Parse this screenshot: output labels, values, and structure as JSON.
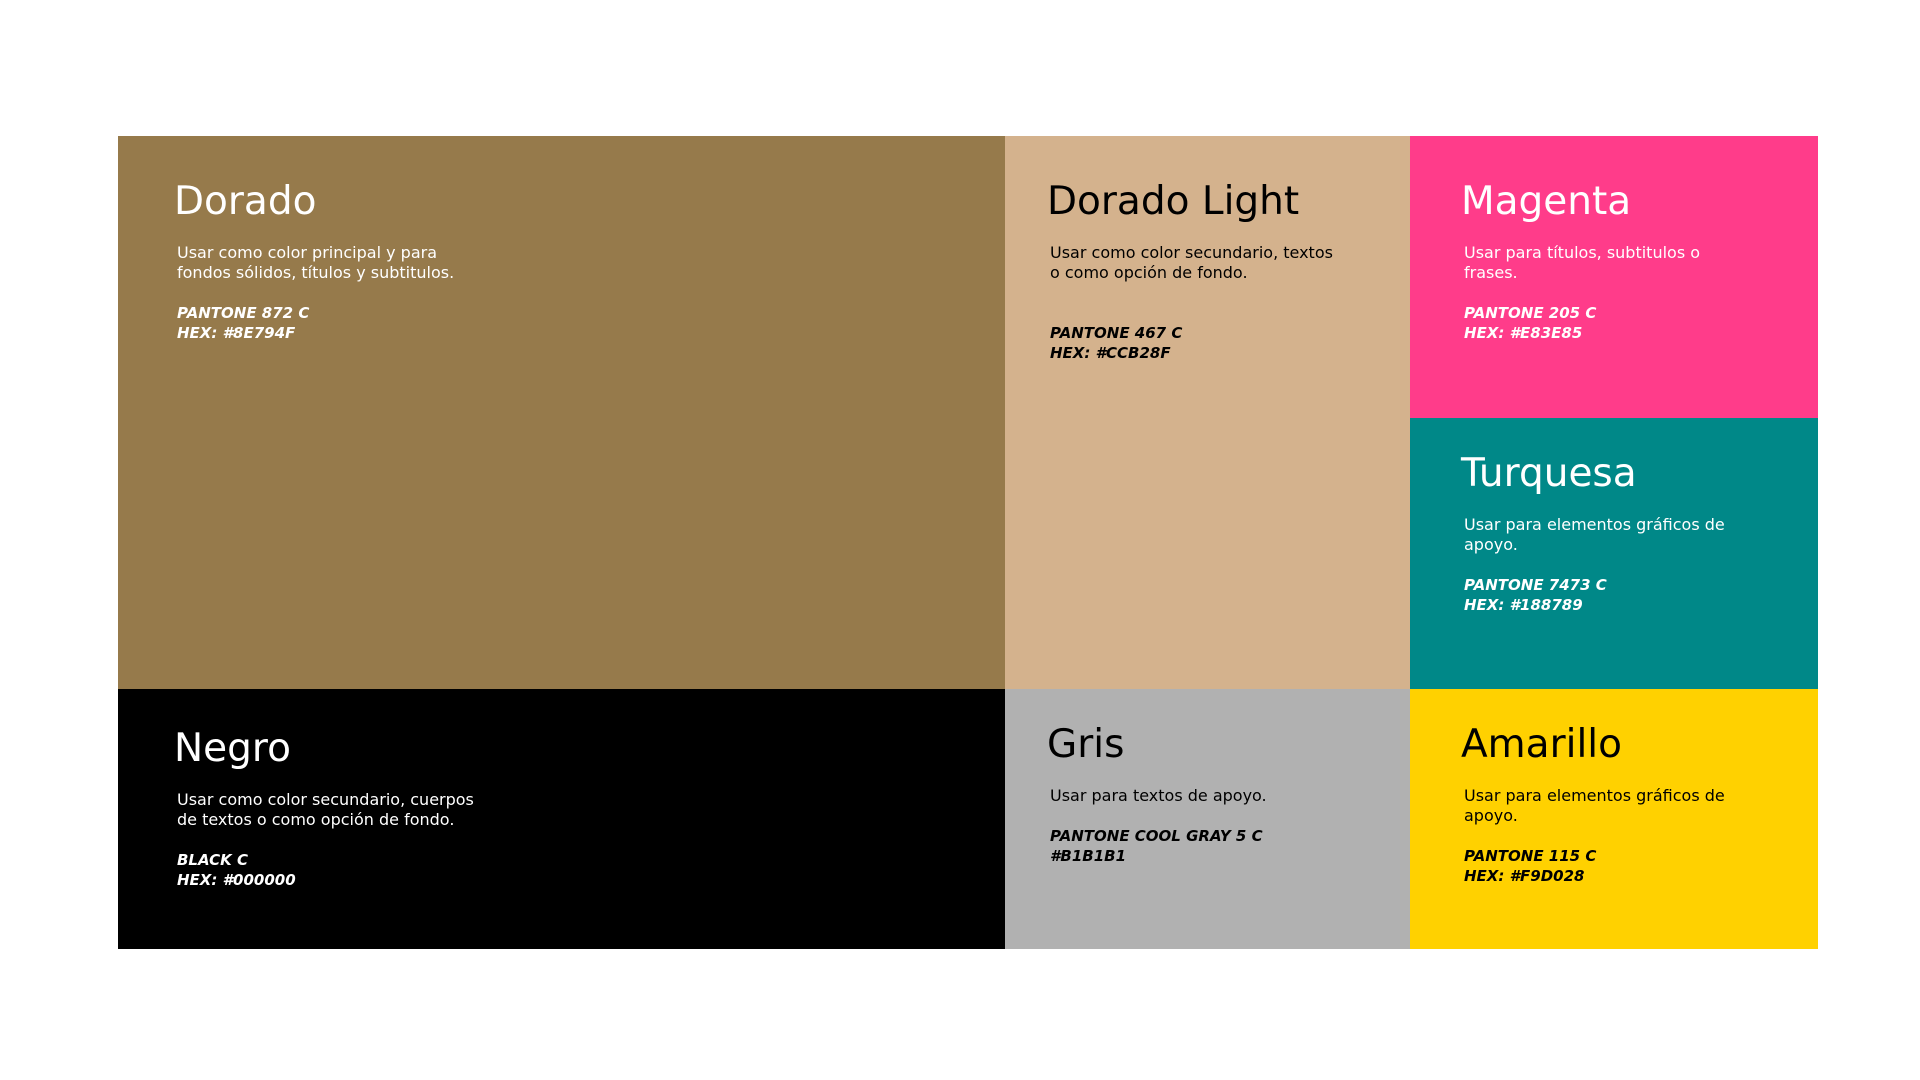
{
  "swatches": {
    "dorado": {
      "name": "Dorado",
      "description": "Usar como color principal y para fondos sólidos, títulos y subtitulos.",
      "pantone": "PANTONE 872 C",
      "hex": "HEX: #8E794F",
      "bg": "#967A4B",
      "text_color": "#ffffff"
    },
    "dorado_light": {
      "name": "Dorado Light",
      "description": "Usar como color secundario, textos o como opción de fondo.",
      "pantone": "PANTONE 467 C",
      "hex": "HEX: #CCB28F",
      "bg": "#D4B28D",
      "text_color": "#000000"
    },
    "magenta": {
      "name": "Magenta",
      "description": "Usar para títulos, subtitulos o frases.",
      "pantone": "PANTONE 205 C",
      "hex": "HEX: #E83E85",
      "bg": "#FF3C8A",
      "text_color": "#ffffff"
    },
    "turquesa": {
      "name": "Turquesa",
      "description": "Usar para elementos gráficos de apoyo.",
      "pantone": "PANTONE 7473 C",
      "hex": "HEX: #188789",
      "bg": "#008888",
      "text_color": "#ffffff"
    },
    "negro": {
      "name": "Negro",
      "description": "Usar como color secundario, cuerpos de textos o como opción de fondo.",
      "pantone": "BLACK C",
      "hex": "HEX: #000000",
      "bg": "#000000",
      "text_color": "#ffffff"
    },
    "gris": {
      "name": "Gris",
      "description": "Usar para textos de apoyo.",
      "pantone": "PANTONE COOL GRAY 5 C",
      "hex": "#B1B1B1",
      "bg": "#B1B1B1",
      "text_color": "#000000"
    },
    "amarillo": {
      "name": "Amarillo",
      "description": "Usar para elementos gráficos de apoyo.",
      "pantone": "PANTONE 115 C",
      "hex": "HEX: #F9D028",
      "bg": "#FFD100",
      "text_color": "#000000"
    }
  }
}
